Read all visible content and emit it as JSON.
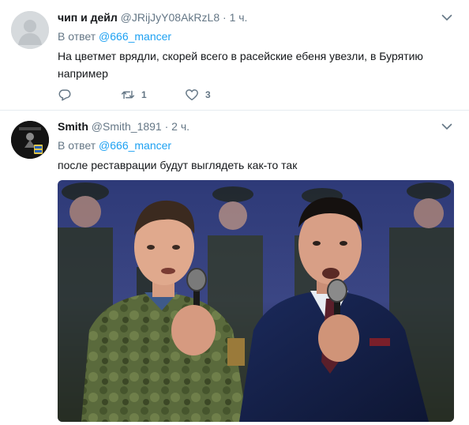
{
  "tweets": [
    {
      "name": "чип и дейл",
      "handle": "@JRijJyY08AkRzL8",
      "dot": "·",
      "time": "1 ч.",
      "reply_prefix": "В ответ",
      "reply_handle": "@666_mancer",
      "text": "На цветмет врядли, скорей всего в расейские ебеня увезли, в Бурятию например",
      "retweet_count": "1",
      "like_count": "3",
      "avatar_icon": "default-avatar-icon"
    },
    {
      "name": "Smith",
      "handle": "@Smith_1891",
      "dot": "·",
      "time": "2 ч.",
      "reply_prefix": "В ответ",
      "reply_handle": "@666_mancer",
      "text": "после реставрации будут выглядеть как-то так",
      "media": "photo of two men singing into microphones on a stage, a choir in military uniforms behind them"
    }
  ],
  "colors": {
    "link": "#1da1f2",
    "secondary": "#657786",
    "divider": "#e6ecf0"
  },
  "icons": [
    "reply-icon",
    "retweet-icon",
    "like-icon",
    "chevron-down-icon"
  ]
}
